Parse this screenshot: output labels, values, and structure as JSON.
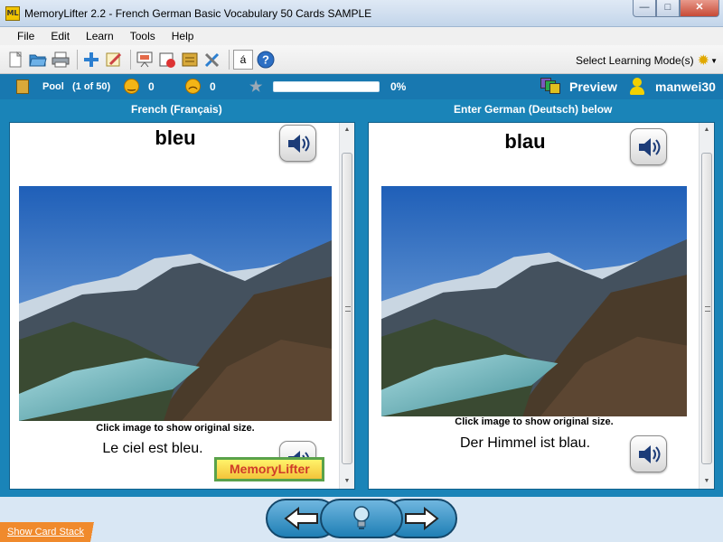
{
  "window": {
    "title": "MemoryLifter 2.2 - French German Basic Vocabulary 50 Cards SAMPLE",
    "app_icon_text": "ML",
    "controls": {
      "minimize": "—",
      "maximize": "□",
      "close": "✕"
    }
  },
  "menu": [
    "File",
    "Edit",
    "Learn",
    "Tools",
    "Help"
  ],
  "toolbar": {
    "mode_label": "Select Learning Mode(s)",
    "buttons": [
      "new-file-icon",
      "open-folder-icon",
      "print-icon",
      "add-card-icon",
      "edit-card-icon",
      "slideshow-icon",
      "statistics-icon",
      "card-box-icon",
      "settings-tools-icon",
      "special-char-icon",
      "help-icon"
    ],
    "special_char": "á"
  },
  "status": {
    "pool_label": "Pool",
    "pool_count": "(1 of 50)",
    "good_score": "0",
    "bad_score": "0",
    "progress_value": 0,
    "progress_text": "0%",
    "preview_label": "Preview",
    "user_name": "manwei30"
  },
  "question": {
    "header": "French (Français)",
    "word": "bleu",
    "caption": "Click image to show original size.",
    "sentence": "Le ciel est bleu.",
    "logo_text": "MemoryLifter"
  },
  "answer": {
    "header": "Enter German (Deutsch) below",
    "word": "blau",
    "caption": "Click image to show original size.",
    "sentence": "Der Himmel ist blau."
  },
  "footer": {
    "show_card_stack": "Show Card Stack"
  },
  "colors": {
    "accent_blue": "#1a84b8",
    "status_blue": "#1878b0",
    "stack_orange": "#f08a2c",
    "smiley_yellow": "#f3b516"
  }
}
